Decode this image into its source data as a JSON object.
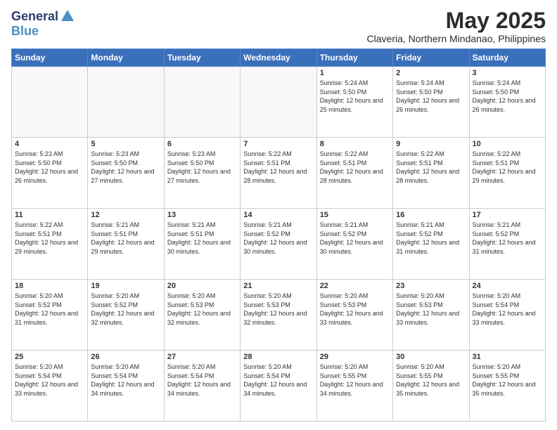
{
  "header": {
    "logo": {
      "general": "General",
      "blue": "Blue"
    },
    "title": "May 2025",
    "subtitle": "Claveria, Northern Mindanao, Philippines"
  },
  "weekdays": [
    "Sunday",
    "Monday",
    "Tuesday",
    "Wednesday",
    "Thursday",
    "Friday",
    "Saturday"
  ],
  "weeks": [
    [
      {
        "day": "",
        "sunrise": "",
        "sunset": "",
        "daylight": ""
      },
      {
        "day": "",
        "sunrise": "",
        "sunset": "",
        "daylight": ""
      },
      {
        "day": "",
        "sunrise": "",
        "sunset": "",
        "daylight": ""
      },
      {
        "day": "",
        "sunrise": "",
        "sunset": "",
        "daylight": ""
      },
      {
        "day": "1",
        "sunrise": "Sunrise: 5:24 AM",
        "sunset": "Sunset: 5:50 PM",
        "daylight": "Daylight: 12 hours and 25 minutes."
      },
      {
        "day": "2",
        "sunrise": "Sunrise: 5:24 AM",
        "sunset": "Sunset: 5:50 PM",
        "daylight": "Daylight: 12 hours and 26 minutes."
      },
      {
        "day": "3",
        "sunrise": "Sunrise: 5:24 AM",
        "sunset": "Sunset: 5:50 PM",
        "daylight": "Daylight: 12 hours and 26 minutes."
      }
    ],
    [
      {
        "day": "4",
        "sunrise": "Sunrise: 5:23 AM",
        "sunset": "Sunset: 5:50 PM",
        "daylight": "Daylight: 12 hours and 26 minutes."
      },
      {
        "day": "5",
        "sunrise": "Sunrise: 5:23 AM",
        "sunset": "Sunset: 5:50 PM",
        "daylight": "Daylight: 12 hours and 27 minutes."
      },
      {
        "day": "6",
        "sunrise": "Sunrise: 5:23 AM",
        "sunset": "Sunset: 5:50 PM",
        "daylight": "Daylight: 12 hours and 27 minutes."
      },
      {
        "day": "7",
        "sunrise": "Sunrise: 5:22 AM",
        "sunset": "Sunset: 5:51 PM",
        "daylight": "Daylight: 12 hours and 28 minutes."
      },
      {
        "day": "8",
        "sunrise": "Sunrise: 5:22 AM",
        "sunset": "Sunset: 5:51 PM",
        "daylight": "Daylight: 12 hours and 28 minutes."
      },
      {
        "day": "9",
        "sunrise": "Sunrise: 5:22 AM",
        "sunset": "Sunset: 5:51 PM",
        "daylight": "Daylight: 12 hours and 28 minutes."
      },
      {
        "day": "10",
        "sunrise": "Sunrise: 5:22 AM",
        "sunset": "Sunset: 5:51 PM",
        "daylight": "Daylight: 12 hours and 29 minutes."
      }
    ],
    [
      {
        "day": "11",
        "sunrise": "Sunrise: 5:22 AM",
        "sunset": "Sunset: 5:51 PM",
        "daylight": "Daylight: 12 hours and 29 minutes."
      },
      {
        "day": "12",
        "sunrise": "Sunrise: 5:21 AM",
        "sunset": "Sunset: 5:51 PM",
        "daylight": "Daylight: 12 hours and 29 minutes."
      },
      {
        "day": "13",
        "sunrise": "Sunrise: 5:21 AM",
        "sunset": "Sunset: 5:51 PM",
        "daylight": "Daylight: 12 hours and 30 minutes."
      },
      {
        "day": "14",
        "sunrise": "Sunrise: 5:21 AM",
        "sunset": "Sunset: 5:52 PM",
        "daylight": "Daylight: 12 hours and 30 minutes."
      },
      {
        "day": "15",
        "sunrise": "Sunrise: 5:21 AM",
        "sunset": "Sunset: 5:52 PM",
        "daylight": "Daylight: 12 hours and 30 minutes."
      },
      {
        "day": "16",
        "sunrise": "Sunrise: 5:21 AM",
        "sunset": "Sunset: 5:52 PM",
        "daylight": "Daylight: 12 hours and 31 minutes."
      },
      {
        "day": "17",
        "sunrise": "Sunrise: 5:21 AM",
        "sunset": "Sunset: 5:52 PM",
        "daylight": "Daylight: 12 hours and 31 minutes."
      }
    ],
    [
      {
        "day": "18",
        "sunrise": "Sunrise: 5:20 AM",
        "sunset": "Sunset: 5:52 PM",
        "daylight": "Daylight: 12 hours and 31 minutes."
      },
      {
        "day": "19",
        "sunrise": "Sunrise: 5:20 AM",
        "sunset": "Sunset: 5:52 PM",
        "daylight": "Daylight: 12 hours and 32 minutes."
      },
      {
        "day": "20",
        "sunrise": "Sunrise: 5:20 AM",
        "sunset": "Sunset: 5:53 PM",
        "daylight": "Daylight: 12 hours and 32 minutes."
      },
      {
        "day": "21",
        "sunrise": "Sunrise: 5:20 AM",
        "sunset": "Sunset: 5:53 PM",
        "daylight": "Daylight: 12 hours and 32 minutes."
      },
      {
        "day": "22",
        "sunrise": "Sunrise: 5:20 AM",
        "sunset": "Sunset: 5:53 PM",
        "daylight": "Daylight: 12 hours and 33 minutes."
      },
      {
        "day": "23",
        "sunrise": "Sunrise: 5:20 AM",
        "sunset": "Sunset: 5:53 PM",
        "daylight": "Daylight: 12 hours and 33 minutes."
      },
      {
        "day": "24",
        "sunrise": "Sunrise: 5:20 AM",
        "sunset": "Sunset: 5:54 PM",
        "daylight": "Daylight: 12 hours and 33 minutes."
      }
    ],
    [
      {
        "day": "25",
        "sunrise": "Sunrise: 5:20 AM",
        "sunset": "Sunset: 5:54 PM",
        "daylight": "Daylight: 12 hours and 33 minutes."
      },
      {
        "day": "26",
        "sunrise": "Sunrise: 5:20 AM",
        "sunset": "Sunset: 5:54 PM",
        "daylight": "Daylight: 12 hours and 34 minutes."
      },
      {
        "day": "27",
        "sunrise": "Sunrise: 5:20 AM",
        "sunset": "Sunset: 5:54 PM",
        "daylight": "Daylight: 12 hours and 34 minutes."
      },
      {
        "day": "28",
        "sunrise": "Sunrise: 5:20 AM",
        "sunset": "Sunset: 5:54 PM",
        "daylight": "Daylight: 12 hours and 34 minutes."
      },
      {
        "day": "29",
        "sunrise": "Sunrise: 5:20 AM",
        "sunset": "Sunset: 5:55 PM",
        "daylight": "Daylight: 12 hours and 34 minutes."
      },
      {
        "day": "30",
        "sunrise": "Sunrise: 5:20 AM",
        "sunset": "Sunset: 5:55 PM",
        "daylight": "Daylight: 12 hours and 35 minutes."
      },
      {
        "day": "31",
        "sunrise": "Sunrise: 5:20 AM",
        "sunset": "Sunset: 5:55 PM",
        "daylight": "Daylight: 12 hours and 35 minutes."
      }
    ]
  ]
}
